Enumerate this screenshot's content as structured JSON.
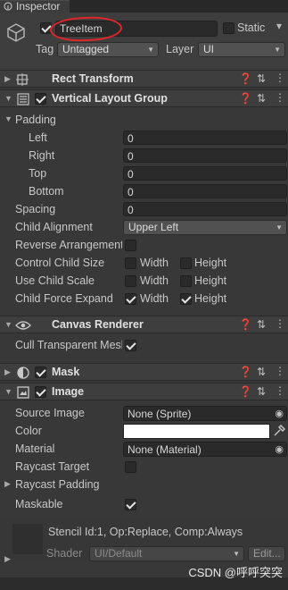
{
  "tab": {
    "label": "Inspector"
  },
  "object": {
    "name": "TreeItem",
    "static_label": "Static",
    "tag_label": "Tag",
    "tag_value": "Untagged",
    "layer_label": "Layer",
    "layer_value": "UI"
  },
  "rect_transform": {
    "title": "Rect Transform"
  },
  "vlg": {
    "title": "Vertical Layout Group",
    "padding_label": "Padding",
    "left_label": "Left",
    "left_value": "0",
    "right_label": "Right",
    "right_value": "0",
    "top_label": "Top",
    "top_value": "0",
    "bottom_label": "Bottom",
    "bottom_value": "0",
    "spacing_label": "Spacing",
    "spacing_value": "0",
    "child_alignment_label": "Child Alignment",
    "child_alignment_value": "Upper Left",
    "reverse_label": "Reverse Arrangement",
    "control_size_label": "Control Child Size",
    "use_scale_label": "Use Child Scale",
    "force_expand_label": "Child Force Expand",
    "width_label": "Width",
    "height_label": "Height"
  },
  "canvas_renderer": {
    "title": "Canvas Renderer",
    "cull_label": "Cull Transparent Mesh"
  },
  "mask": {
    "title": "Mask"
  },
  "image": {
    "title": "Image",
    "source_label": "Source Image",
    "source_value": "None (Sprite)",
    "color_label": "Color",
    "material_label": "Material",
    "material_value": "None (Material)",
    "raycast_target_label": "Raycast Target",
    "raycast_padding_label": "Raycast Padding",
    "maskable_label": "Maskable"
  },
  "material_preview": {
    "stencil_text": "Stencil Id:1, Op:Replace, Comp:Always",
    "shader_label": "Shader",
    "shader_value": "UI/Default",
    "edit_label": "Edit..."
  },
  "watermark": "CSDN @呼呼突突",
  "colors": {
    "accent": "#e0262a",
    "panel": "#383838",
    "header": "#3e3e3e"
  }
}
